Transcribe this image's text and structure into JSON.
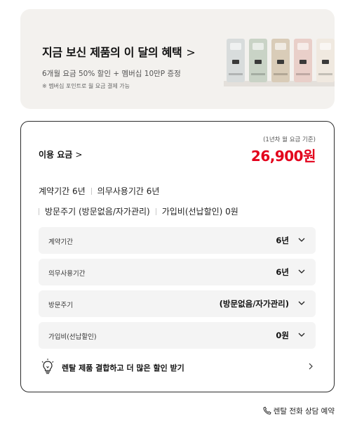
{
  "banner": {
    "title": "지금 보신 제품의 이 달의 혜택",
    "title_chevron": ">",
    "subtitle": "6개월 요금 50% 할인 + 멤버십 10만P 증정",
    "note": "※ 멤버십 포인트로 월 요금 결제 가능",
    "product_colors": [
      "#d8dcdc",
      "#c9d3c6",
      "#d9ccb8",
      "#e9cfc9",
      "#f0e9e0"
    ]
  },
  "fee": {
    "label": "이용 요금",
    "chevron": ">",
    "basis": "(1년차 월 요금 기준)",
    "price": "26,900원",
    "price_color": "#e3001b"
  },
  "summary": {
    "contract": "계약기간 6년",
    "mandatory": "의무사용기간 6년",
    "visit": "방문주기 (방문없음/자가관리)",
    "join_fee": "가입비(선납할인) 0원"
  },
  "options": [
    {
      "label": "계약기간",
      "value": "6년",
      "icon": "chevron-down-icon"
    },
    {
      "label": "의무사용기간",
      "value": "6년",
      "icon": "chevron-down-icon"
    },
    {
      "label": "방문주기",
      "value": "(방문없음/자가관리)",
      "icon": "chevron-down-icon"
    },
    {
      "label": "가입비(선납할인)",
      "value": "0원",
      "icon": "chevron-down-icon"
    }
  ],
  "combine": {
    "icon": "lightbulb-icon",
    "text": "렌탈 제품 결합하고 더 많은 할인 받기",
    "chevron_icon": "chevron-right-icon"
  },
  "call": {
    "icon": "phone-icon",
    "text": "렌탈 전화 상담 예약"
  }
}
